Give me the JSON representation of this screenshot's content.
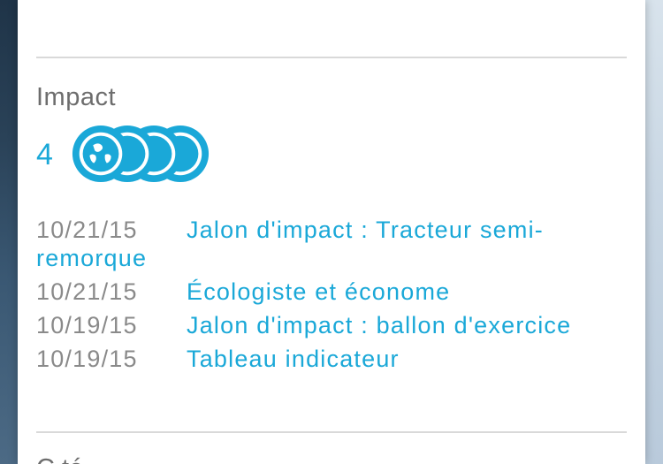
{
  "impact": {
    "title": "Impact",
    "count": "4",
    "badge_count": 4,
    "badge_icon": "globe-icon",
    "accent_color": "#1aa8d8"
  },
  "events": [
    {
      "date": "10/21/15",
      "title": "Jalon d'impact : Tracteur semi-remorque"
    },
    {
      "date": "10/21/15",
      "title": "Écologiste et économe"
    },
    {
      "date": "10/19/15",
      "title": "Jalon d'impact : ballon d'exercice"
    },
    {
      "date": "10/19/15",
      "title": "Tableau indicateur"
    }
  ],
  "next_section": {
    "title": "C               té"
  }
}
